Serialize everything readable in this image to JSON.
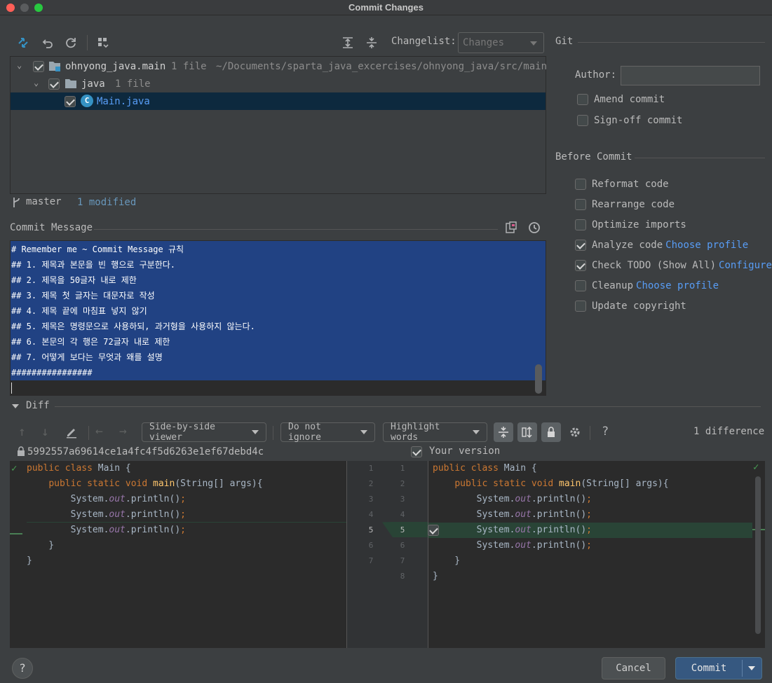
{
  "window": {
    "title": "Commit Changes"
  },
  "toolbar": {
    "changelist_label": "Changelist:",
    "changelist_value": "Changes"
  },
  "tree": {
    "root": {
      "name": "ohnyong_java.main",
      "count": "1 file",
      "path": "~/Documents/sparta_java_excercises/ohnyong_java/src/main"
    },
    "folder": {
      "name": "java",
      "count": "1 file"
    },
    "file": {
      "name": "Main.java"
    }
  },
  "status": {
    "branch": "master",
    "modified": "1 modified"
  },
  "commit_message": {
    "label": "Commit Message",
    "lines": [
      "# Remember me ~ Commit Message 규칙",
      "## 1. 제목과 본문을 빈 행으로 구분한다.",
      "## 2. 제목을 50글자 내로 제한",
      "## 3. 제목 첫 글자는 대문자로 작성",
      "## 4. 제목 끝에 마침표 넣지 않기",
      "## 5. 제목은 명령문으로 사용하되, 과거형을 사용하지 않는다.",
      "## 6. 본문의 각 행은 72글자 내로 제한",
      "## 7. 어떻게 보다는 무엇과 왜를 설명",
      "################"
    ]
  },
  "git": {
    "section": "Git",
    "author_label": "Author:",
    "author_value": "",
    "amend": "Amend commit",
    "signoff": "Sign-off commit"
  },
  "before_commit": {
    "section": "Before Commit",
    "reformat": "Reformat code",
    "rearrange": "Rearrange code",
    "optimize": "Optimize imports",
    "analyze": "Analyze code",
    "analyze_link": "Choose profile",
    "todo": "Check TODO (Show All)",
    "todo_link": "Configure",
    "cleanup": "Cleanup",
    "cleanup_link": "Choose profile",
    "copyright": "Update copyright"
  },
  "diff": {
    "section": "Diff",
    "viewer": "Side-by-side viewer",
    "ignore": "Do not ignore",
    "highlight": "Highlight words",
    "count": "1 difference",
    "left_title": "5992557a69614ce1a4fc4f5d6263e1ef67debd4c",
    "right_title": "Your version",
    "left_numbers": [
      "1",
      "2",
      "3",
      "4",
      "5",
      "6",
      "7"
    ],
    "right_numbers": [
      "1",
      "2",
      "3",
      "4",
      "5",
      "6",
      "7",
      "8"
    ]
  },
  "footer": {
    "cancel": "Cancel",
    "commit": "Commit"
  },
  "colors": {
    "selection": "#0d293e",
    "message_bg": "#214283",
    "added_line": "#294436",
    "primary_button": "#365880"
  }
}
